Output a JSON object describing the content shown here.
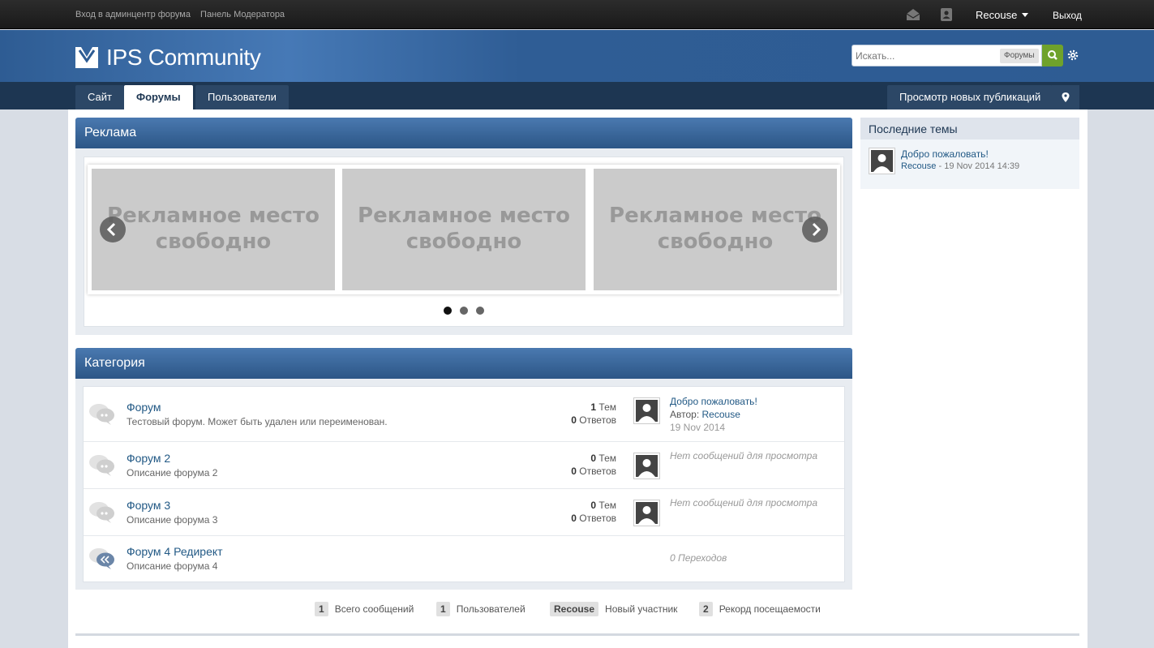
{
  "topbar": {
    "admin_link": "Вход в админцентр форума",
    "mod_link": "Панель Модератора",
    "username": "Recouse",
    "logout": "Выход"
  },
  "header": {
    "logo_text": "IPS Community",
    "search_placeholder": "Искать...",
    "search_scope": "Форумы"
  },
  "nav": {
    "tabs": [
      "Сайт",
      "Форумы",
      "Пользователи"
    ],
    "active_tab": "Форумы",
    "new_content": "Просмотр новых публикаций"
  },
  "ads": {
    "title": "Реклама",
    "slides": [
      {
        "line1": "Рекламное место",
        "line2": "свободно"
      },
      {
        "line1": "Рекламное место",
        "line2": "свободно"
      },
      {
        "line1": "Рекламное место",
        "line2": "свободно"
      }
    ],
    "active_dot": 1
  },
  "category": {
    "title": "Категория",
    "forums": [
      {
        "name": "Форум",
        "desc": "Тестовый форум. Может быть удален или переименован.",
        "topics": "1",
        "topics_label": "Тем",
        "replies": "0",
        "replies_label": "Ответов",
        "last_title": "Добро пожаловать!",
        "last_author_label": "Автор:",
        "last_author": "Recouse",
        "last_date": "19 Nov 2014"
      },
      {
        "name": "Форум 2",
        "desc": "Описание форума 2",
        "topics": "0",
        "topics_label": "Тем",
        "replies": "0",
        "replies_label": "Ответов",
        "no_posts": "Нет сообщений для просмотра"
      },
      {
        "name": "Форум 3",
        "desc": "Описание форума 3",
        "topics": "0",
        "topics_label": "Тем",
        "replies": "0",
        "replies_label": "Ответов",
        "no_posts": "Нет сообщений для просмотра"
      },
      {
        "name": "Форум 4 Редирект",
        "desc": "Описание форума 4",
        "redirects": "0 Переходов"
      }
    ]
  },
  "stats": [
    {
      "value": "1",
      "label": "Всего сообщений"
    },
    {
      "value": "1",
      "label": "Пользователей"
    },
    {
      "value": "Recouse",
      "label": "Новый участник"
    },
    {
      "value": "2",
      "label": "Рекорд посещаемости"
    }
  ],
  "sidebar": {
    "title": "Последние темы",
    "topic_title": "Добро пожаловать!",
    "topic_author": "Recouse",
    "topic_meta": " - 19 Nov 2014 14:39"
  }
}
